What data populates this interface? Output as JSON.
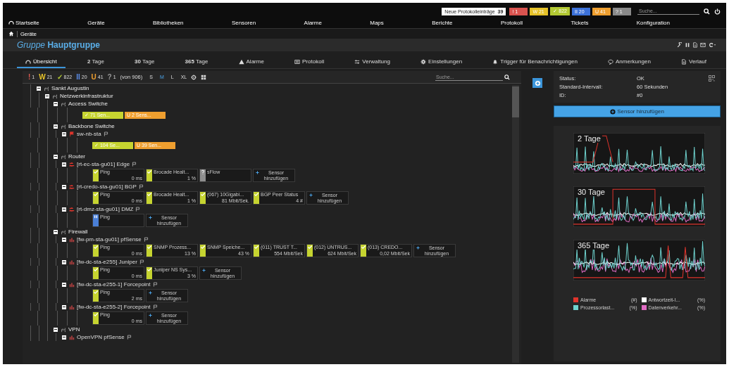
{
  "top_bar": {
    "notification": {
      "label": "Neue Protokolleinträge",
      "count": "39"
    },
    "status_badges": [
      {
        "symbol": "!",
        "count": "1",
        "color": "#d9534f"
      },
      {
        "symbol": "W",
        "count": "21",
        "color": "#e6c229"
      },
      {
        "symbol": "✓",
        "count": "822",
        "color": "#b3c933"
      },
      {
        "symbol": "II",
        "count": "20",
        "color": "#3d72d9"
      },
      {
        "symbol": "U",
        "count": "41",
        "color": "#ef9f2f"
      },
      {
        "symbol": "?",
        "count": "1",
        "color": "#8a8a8a"
      }
    ],
    "search": {
      "placeholder": "Suche..."
    }
  },
  "nav": [
    {
      "label": "Startseite"
    },
    {
      "label": "Geräte"
    },
    {
      "label": "Bibliotheken"
    },
    {
      "label": "Sensoren"
    },
    {
      "label": "Alarme"
    },
    {
      "label": "Maps"
    },
    {
      "label": "Berichte"
    },
    {
      "label": "Protokoll"
    },
    {
      "label": "Tickets"
    },
    {
      "label": "Konfiguration"
    }
  ],
  "breadcrumb": [
    "Geräte"
  ],
  "page_title": {
    "prefix": "Gruppe",
    "name": "Hauptgruppe"
  },
  "tabs": [
    {
      "label": "Übersicht",
      "selected": true
    },
    {
      "label": "**2** Tage",
      "selected": false
    },
    {
      "label": "**30** Tage",
      "selected": false
    },
    {
      "label": "**365** Tage",
      "selected": false
    },
    {
      "label": "Alarme",
      "selected": false
    },
    {
      "label": "Protokoll",
      "selected": false
    },
    {
      "label": "Verwaltung",
      "selected": false
    },
    {
      "label": "Einstellungen",
      "selected": false
    },
    {
      "label": "Trigger für Benachrichtigungen",
      "selected": false
    },
    {
      "label": "Anmerkungen",
      "selected": false
    },
    {
      "label": "Verlauf",
      "selected": false
    }
  ],
  "toolbar": {
    "counters": [
      {
        "symbol": "!",
        "count": "1",
        "color": "#e05a50"
      },
      {
        "symbol": "W",
        "count": "21",
        "color": "#e6c229"
      },
      {
        "symbol": "✓",
        "count": "822",
        "color": "#b3c933"
      },
      {
        "symbol": "II",
        "count": "20",
        "color": "#5b8ce8"
      },
      {
        "symbol": "U",
        "count": "41",
        "color": "#ef9f2f"
      },
      {
        "symbol": "?",
        "count": "1",
        "color": "#9a9a9a"
      }
    ],
    "total": "(von 906)",
    "sizes": [
      {
        "label": "S",
        "selected": false
      },
      {
        "label": "M",
        "selected": true
      },
      {
        "label": "L",
        "selected": false
      },
      {
        "label": "XL",
        "selected": false
      }
    ],
    "search": {
      "placeholder": "Suche..."
    }
  },
  "tree": [
    {
      "kind": "group",
      "name": "Sankt Augustin",
      "expanded": true,
      "children": [
        {
          "kind": "group",
          "name": "Netzwerkinfrastruktur",
          "expanded": true,
          "children": [
            {
              "kind": "group",
              "name": "Access Switche",
              "expanded": true,
              "summary": [
                {
                  "kind": "ok",
                  "symbol": "✓",
                  "label": "71 Sen..."
                },
                {
                  "kind": "unusual",
                  "symbol": "U",
                  "label": "2 Sens..."
                }
              ]
            },
            {
              "kind": "group",
              "name": "Backbone Switche",
              "expanded": true,
              "children": [
                {
                  "kind": "switch",
                  "name": "sw-nb-sta",
                  "summary": [
                    {
                      "kind": "ok",
                      "symbol": "✓",
                      "label": "104 Se..."
                    },
                    {
                      "kind": "unusual",
                      "symbol": "U",
                      "label": "39 Sen..."
                    }
                  ]
                }
              ]
            },
            {
              "kind": "group",
              "name": "Router",
              "expanded": true,
              "children": [
                {
                  "kind": "router",
                  "name": "[rt-ec-sta-gu01] Edge",
                  "sensors": [
                    {
                      "kind": "ok",
                      "name": "Ping",
                      "value": "0 ms"
                    },
                    {
                      "kind": "ok",
                      "name": "Brocade Healt...",
                      "value": "1 %"
                    },
                    {
                      "kind": "unknown",
                      "name": "sFlow"
                    },
                    {
                      "kind": "add",
                      "label": "Sensor hinzufügen"
                    }
                  ]
                },
                {
                  "kind": "router",
                  "name": "[rt-credo-sta-gu01] BGP",
                  "sensors": [
                    {
                      "kind": "ok",
                      "name": "Ping",
                      "value": "0 ms"
                    },
                    {
                      "kind": "ok",
                      "name": "Brocade Healt...",
                      "value": "1 %"
                    },
                    {
                      "kind": "ok",
                      "name": "(067) 10Gigabi...",
                      "value": "81 Mbit/Sek."
                    },
                    {
                      "kind": "ok",
                      "name": "BGP Peer Status",
                      "value": "4 #"
                    },
                    {
                      "kind": "add",
                      "label": "Sensor hinzufügen"
                    }
                  ]
                },
                {
                  "kind": "router",
                  "name": "[rt-dmz-sta-gu01] DMZ",
                  "sensors": [
                    {
                      "kind": "paused",
                      "name": "Ping"
                    },
                    {
                      "kind": "add",
                      "label": "Sensor hinzufügen"
                    }
                  ]
                }
              ]
            },
            {
              "kind": "group",
              "name": "Firewall",
              "expanded": true,
              "children": [
                {
                  "kind": "firewall",
                  "name": "[fw-pm-sta-gu01] pfSense",
                  "sensors": [
                    {
                      "kind": "ok",
                      "name": "Ping",
                      "value": "0 ms"
                    },
                    {
                      "kind": "ok",
                      "name": "SNMP Prozess...",
                      "value": "13 %"
                    },
                    {
                      "kind": "ok",
                      "name": "SNMP Speiche...",
                      "value": "43 %"
                    },
                    {
                      "kind": "ok",
                      "name": "(011) TRUST T...",
                      "value": "554 Mbit/Sek"
                    },
                    {
                      "kind": "ok",
                      "name": "(012) UNTRUS...",
                      "value": "624 Mbit/Sek"
                    },
                    {
                      "kind": "ok",
                      "name": "(013) CREDO...",
                      "value": "0,02 Mbit/Sek"
                    },
                    {
                      "kind": "add",
                      "label": "Sensor hinzufügen"
                    }
                  ]
                },
                {
                  "kind": "firewall",
                  "name": "[fw-dc-sta-e255] Juniper",
                  "sensors": [
                    {
                      "kind": "ok",
                      "name": "Ping",
                      "value": "0 ms"
                    },
                    {
                      "kind": "ok",
                      "name": "Juniper NS Sys...",
                      "value": "3 %"
                    },
                    {
                      "kind": "add",
                      "label": "Sensor hinzufügen"
                    }
                  ]
                },
                {
                  "kind": "firewall",
                  "name": "[fw-dc-sta-e255-1] Forcepoint",
                  "sensors": [
                    {
                      "kind": "ok",
                      "name": "Ping",
                      "value": "2 ms"
                    },
                    {
                      "kind": "add",
                      "label": "Sensor hinzufügen"
                    }
                  ]
                },
                {
                  "kind": "firewall",
                  "name": "[fw-dc-sta-e255-2] Forcepoint",
                  "sensors": [
                    {
                      "kind": "ok",
                      "name": "Ping",
                      "value": "0 ms"
                    },
                    {
                      "kind": "add",
                      "label": "Sensor hinzufügen"
                    }
                  ]
                }
              ]
            },
            {
              "kind": "group",
              "name": "VPN",
              "expanded": true,
              "children": [
                {
                  "kind": "firewall",
                  "name": "OpenVPN pfSense"
                }
              ]
            }
          ]
        }
      ]
    }
  ],
  "details": [
    {
      "label": "Status:",
      "value": "OK"
    },
    {
      "label": "Standard-Intervall:",
      "value": "60 Sekunden"
    },
    {
      "label": "ID:",
      "value": "#0"
    }
  ],
  "add_sensor_button": "Sensor hinzufügen",
  "charts": [
    {
      "title": "2 Tage"
    },
    {
      "title": "30 Tage"
    },
    {
      "title": "365 Tage"
    }
  ],
  "legend": [
    {
      "label": "Alarme",
      "unit": "(#)",
      "color": "#e0342c"
    },
    {
      "label": "Antwortzeit-I...",
      "unit": "(%)",
      "color": "#ffffff"
    },
    {
      "label": "Prozessorlast...",
      "unit": "(%)",
      "color": "#6fd3cf"
    },
    {
      "label": "Datenverkehr...",
      "unit": "(%)",
      "color": "#e06cc4"
    }
  ]
}
